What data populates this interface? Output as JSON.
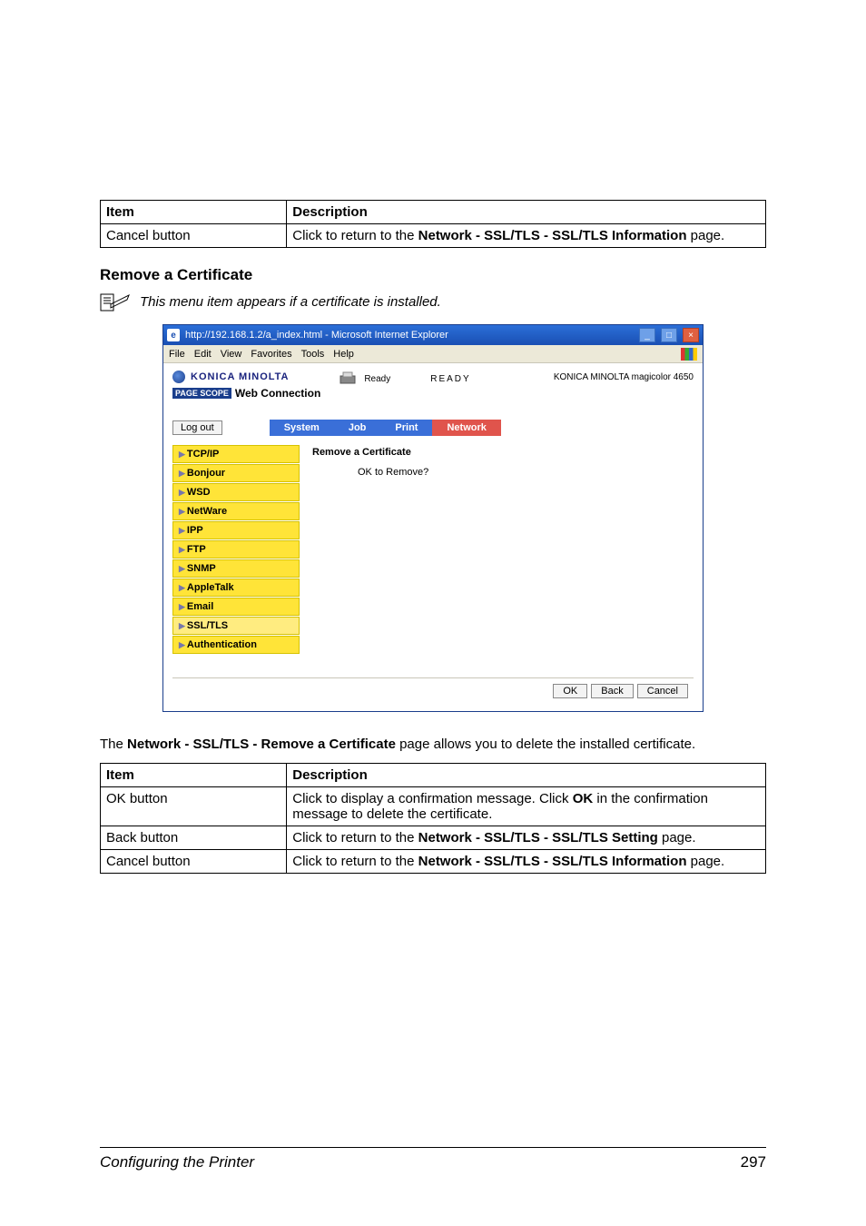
{
  "top_table": {
    "headers": [
      "Item",
      "Description"
    ],
    "row": {
      "item": "Cancel button",
      "desc_pre": "Click to return to the ",
      "desc_bold": "Network - SSL/TLS - SSL/TLS Information",
      "desc_post": " page."
    }
  },
  "section_title": "Remove a Certificate",
  "note": "This menu item appears if a certificate is installed.",
  "browser": {
    "title": "http://192.168.1.2/a_index.html - Microsoft Internet Explorer",
    "menus": [
      "File",
      "Edit",
      "View",
      "Favorites",
      "Tools",
      "Help"
    ],
    "brand": "KONICA MINOLTA",
    "pagescope": "PAGE SCOPE",
    "webconn": "Web Connection",
    "ready_small": "Ready",
    "ready_big": "READY",
    "printer_name": "KONICA MINOLTA magicolor 4650",
    "logout": "Log out",
    "tabs": [
      "System",
      "Job",
      "Print",
      "Network"
    ],
    "sidebar": [
      "TCP/IP",
      "Bonjour",
      "WSD",
      "NetWare",
      "IPP",
      "FTP",
      "SNMP",
      "AppleTalk",
      "Email",
      "SSL/TLS",
      "Authentication"
    ],
    "content_heading": "Remove a Certificate",
    "content_msg": "OK to Remove?",
    "buttons": [
      "OK",
      "Back",
      "Cancel"
    ]
  },
  "body_text": {
    "pre": "The ",
    "bold": "Network - SSL/TLS - Remove a Certificate",
    "post": " page allows you to delete the installed certificate."
  },
  "bottom_table": {
    "headers": [
      "Item",
      "Description"
    ],
    "rows": [
      {
        "item": "OK button",
        "desc_pre": "Click to display a confirmation message. Click ",
        "desc_bold": "OK",
        "desc_post": " in the confirmation message to delete the certificate."
      },
      {
        "item": "Back button",
        "desc_pre": "Click to return to the ",
        "desc_bold": "Network - SSL/TLS - SSL/TLS Setting",
        "desc_post": " page."
      },
      {
        "item": "Cancel button",
        "desc_pre": "Click to return to the ",
        "desc_bold": "Network - SSL/TLS - SSL/TLS Information",
        "desc_post": " page."
      }
    ]
  },
  "footer": {
    "section": "Configuring the Printer",
    "page": "297"
  }
}
